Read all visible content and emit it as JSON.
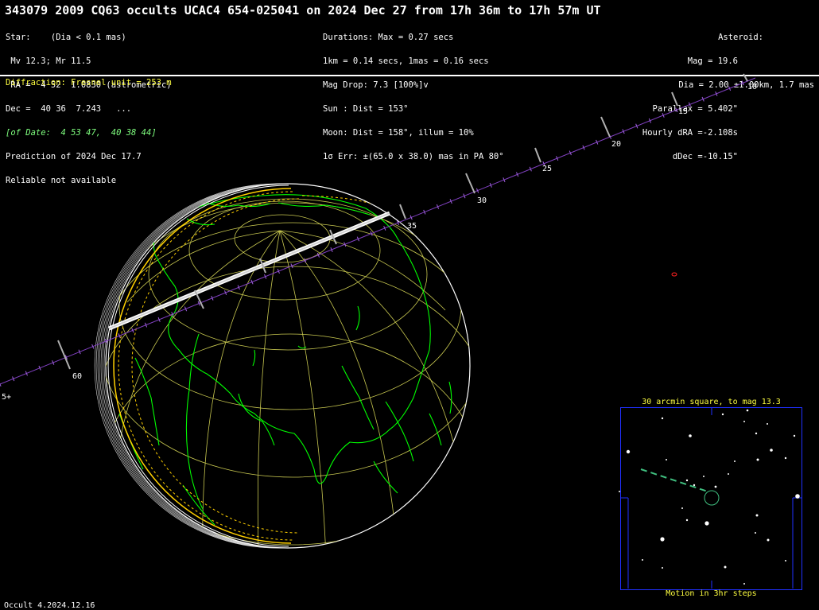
{
  "title": "343079 2009 CQ63 occults UCAC4 654-025041 on 2024 Dec 27 from 17h 36m to 17h 57m UT",
  "star": {
    "lines": [
      "Star:    (Dia < 0.1 mas)",
      " Mv 12.3; Mr 11.5",
      " RA =  4 52  1.0830 (astrometric)",
      "Dec =  40 36  7.243   ..."
    ],
    "of_date": "[of Date:  4 53 47,  40 38 44]",
    "prediction": "Prediction of 2024 Dec 17.7",
    "reliable": "Reliable not available"
  },
  "durations": {
    "lines": [
      "Durations: Max = 0.27 secs",
      "1km = 0.14 secs, 1mas = 0.16 secs",
      "Mag Drop: 7.3 [100%]v",
      "Sun : Dist = 153°",
      "Moon: Dist = 158°, illum = 10%",
      "1σ Err: ±(65.0 x 38.0) mas in PA 80°"
    ]
  },
  "asteroid": {
    "lines": [
      "Asteroid:",
      "Mag = 19.6",
      "Dia = 2.00 ±1.00km, 1.7 mas",
      "Parallax = 5.402\"",
      "Hourly dRA =-2.108s",
      "dDec =-10.15\""
    ]
  },
  "diffraction": "Diffraction: Fresnel unit = 253 m",
  "path_ticks": [
    "10",
    "15",
    "20",
    "25",
    "30",
    "35",
    "60",
    "5+"
  ],
  "starchart": {
    "title": "30 arcmin square, to mag 13.3",
    "caption": "Motion in 3hr steps"
  },
  "version": "Occult 4.2024.12.16",
  "colors": {
    "coast": "#00ff00",
    "grid": "#c8c850",
    "path": "#ffffff",
    "track": "#8040c0",
    "shadow_edge": "#ffd000",
    "label": "#ffff40",
    "box": "#2030ff",
    "motion": "#40c080"
  }
}
